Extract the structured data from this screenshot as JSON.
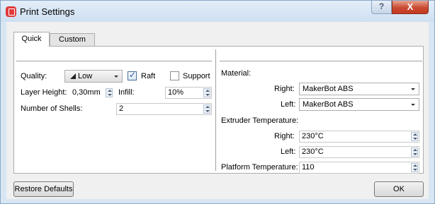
{
  "window": {
    "title": "Print Settings",
    "help_label": "?",
    "close_label": "X"
  },
  "tabs": [
    {
      "label": "Quick",
      "active": true
    },
    {
      "label": "Custom",
      "active": false
    }
  ],
  "quick": {
    "quality": {
      "label": "Quality:",
      "value": "Low"
    },
    "raft": {
      "label": "Raft",
      "checked": true
    },
    "support": {
      "label": "Support",
      "checked": false
    },
    "layer_height": {
      "label": "Layer Height:",
      "value": "0,30mm"
    },
    "infill": {
      "label": "Infill:",
      "value": "10%"
    },
    "shells": {
      "label": "Number of Shells:",
      "value": "2"
    }
  },
  "material": {
    "label": "Material:",
    "right": {
      "label": "Right:",
      "value": "MakerBot ABS"
    },
    "left": {
      "label": "Left:",
      "value": "MakerBot ABS"
    }
  },
  "extruder": {
    "label": "Extruder Temperature:",
    "right": {
      "label": "Right:",
      "value": "230°C"
    },
    "left": {
      "label": "Left:",
      "value": "230°C"
    }
  },
  "platform": {
    "label": "Platform Temperature:",
    "value": "110"
  },
  "buttons": {
    "restore": "Restore Defaults",
    "ok": "OK"
  },
  "colors": {
    "close_button": "#c84a31",
    "app_icon": "#e03a3a",
    "titlebar": "#d8e6f4"
  }
}
